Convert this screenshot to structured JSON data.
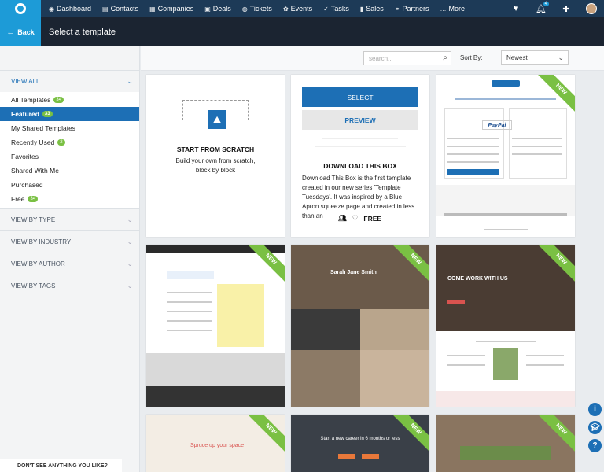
{
  "nav": {
    "items": [
      {
        "icon": "dashboard-icon",
        "glyph": "◉",
        "label": "Dashboard"
      },
      {
        "icon": "contacts-icon",
        "glyph": "▤",
        "label": "Contacts"
      },
      {
        "icon": "companies-icon",
        "glyph": "▦",
        "label": "Companies"
      },
      {
        "icon": "deals-icon",
        "glyph": "▣",
        "label": "Deals"
      },
      {
        "icon": "tickets-icon",
        "glyph": "◍",
        "label": "Tickets"
      },
      {
        "icon": "events-icon",
        "glyph": "✿",
        "label": "Events"
      },
      {
        "icon": "tasks-icon",
        "glyph": "✓",
        "label": "Tasks"
      },
      {
        "icon": "sales-icon",
        "glyph": "▮",
        "label": "Sales"
      },
      {
        "icon": "partners-icon",
        "glyph": "⚭",
        "label": "Partners"
      },
      {
        "icon": "more-icon",
        "glyph": "…",
        "label": "More"
      }
    ],
    "notification_count": "4"
  },
  "header": {
    "back_label": "Back",
    "title": "Select a template"
  },
  "sidebar": {
    "view_all": "VIEW ALL",
    "items": [
      {
        "label": "All Templates",
        "badge": "34"
      },
      {
        "label": "Featured",
        "badge": "33",
        "selected": true
      },
      {
        "label": "My Shared Templates",
        "badge": ""
      },
      {
        "label": "Recently Used",
        "badge": "2"
      },
      {
        "label": "Favorites",
        "badge": ""
      },
      {
        "label": "Shared With Me",
        "badge": ""
      },
      {
        "label": "Purchased",
        "badge": ""
      },
      {
        "label": "Free",
        "badge": "34"
      }
    ],
    "sections": [
      "VIEW BY TYPE",
      "VIEW BY INDUSTRY",
      "VIEW BY AUTHOR",
      "VIEW BY TAGS"
    ],
    "bottom_text": "DON'T SEE ANYTHING YOU LIKE?"
  },
  "toolbar": {
    "search_placeholder": "search...",
    "sort_label": "Sort By:",
    "sort_value": "Newest"
  },
  "cards": {
    "scratch": {
      "title": "START FROM SCRATCH",
      "desc": "Build your own from scratch, block by block"
    },
    "download": {
      "select_label": "SELECT",
      "preview_label": "PREVIEW",
      "title": "DOWNLOAD THIS BOX",
      "desc": "Download This Box is the first template created in our new series 'Template Tuesdays'. It was inspired by a Blue Apron squeeze page and created in less than an",
      "price": "FREE"
    },
    "new_label": "NEW",
    "thumb_texts": {
      "paypal": "PayPal",
      "jane": "Sarah Jane Smith",
      "come": "COME WORK WITH US",
      "spruce": "Spruce up your space",
      "career": "Start a new career in 6 months or less"
    }
  },
  "colors": {
    "nav_bg": "#1d3a57",
    "accent": "#1d9bd7",
    "primary": "#1d6fb5",
    "new_ribbon": "#7ac043"
  }
}
